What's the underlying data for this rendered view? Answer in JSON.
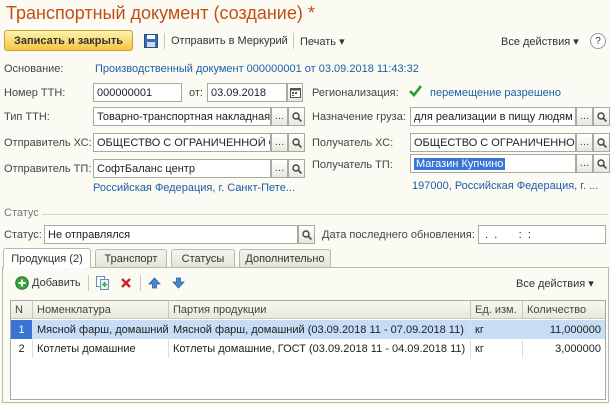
{
  "title": "Транспортный документ (создание) *",
  "toolbar": {
    "save_close": "Записать и закрыть",
    "send_mercury": "Отправить в Меркурий",
    "print": "Печать ▾",
    "all_actions": "Все действия ▾",
    "help": "?"
  },
  "form": {
    "basis_label": "Основание:",
    "basis_value": "Производственный документ 000000001 от 03.09.2018 11:43:32",
    "ttn_label": "Номер ТТН:",
    "ttn_value": "000000001",
    "from_label": "от:",
    "date_value": "03.09.2018",
    "region_label": "Регионализация:",
    "region_value": "перемещение разрешено",
    "ttn_type_label": "Тип ТТН:",
    "ttn_type_value": "Товарно-транспортная накладная",
    "purpose_label": "Назначение груза:",
    "purpose_value": "для реализации в пищу людям",
    "sender_hs_label": "Отправитель ХС:",
    "sender_hs_value": "ОБЩЕСТВО С ОГРАНИЧЕННОЙ ОТВЕТСТВЕННОСТЬЮ",
    "receiver_hs_label": "Получатель ХС:",
    "receiver_hs_value": "ОБЩЕСТВО С ОГРАНИЧЕННОЙ ОТВЕТСТВЕННОСТЬЮ",
    "sender_tp_label": "Отправитель ТП:",
    "sender_tp_value": "СофтБаланс центр",
    "receiver_tp_label": "Получатель ТП:",
    "receiver_tp_value": "Магазин Купчино",
    "sender_address": "Российская Федерация, г. Санкт-Пете...",
    "receiver_address": "197000, Российская Федерация, г. ..."
  },
  "status": {
    "section": "Статус",
    "label": "Статус:",
    "value": "Не отправлялся",
    "last_update_label": "Дата последнего обновления:",
    "last_update_value": " .  .       :  :"
  },
  "tabs": [
    "Продукция (2)",
    "Транспорт",
    "Статусы",
    "Дополнительно"
  ],
  "products_toolbar": {
    "add": "Добавить",
    "all_actions": "Все действия ▾"
  },
  "table": {
    "headers": [
      "N",
      "Номенклатура",
      "Партия продукции",
      "Ед. изм.",
      "Количество"
    ],
    "rows": [
      [
        "1",
        "Мясной фарш, домашний",
        "Мясной фарш, домашний (03.09.2018 11 - 07.09.2018 11)",
        "кг",
        "11,000000"
      ],
      [
        "2",
        "Котлеты домашние",
        "Котлеты домашние, ГОСТ (03.09.2018 11 - 04.09.2018 11)",
        "кг",
        "3,000000"
      ]
    ]
  },
  "colors": {
    "title": "#c24e16",
    "link": "#1c5fa8",
    "selected_row": "#c7dcf5",
    "check": "#2e9b2e"
  },
  "icons": {
    "save": "floppy-icon",
    "region_ok": "check-icon",
    "calendar": "calendar-icon",
    "search": "magnifier-icon",
    "add": "plus-circle-icon",
    "copy": "copy-icon",
    "delete": "delete-x-icon",
    "up": "arrow-up-icon",
    "down": "arrow-down-icon"
  }
}
